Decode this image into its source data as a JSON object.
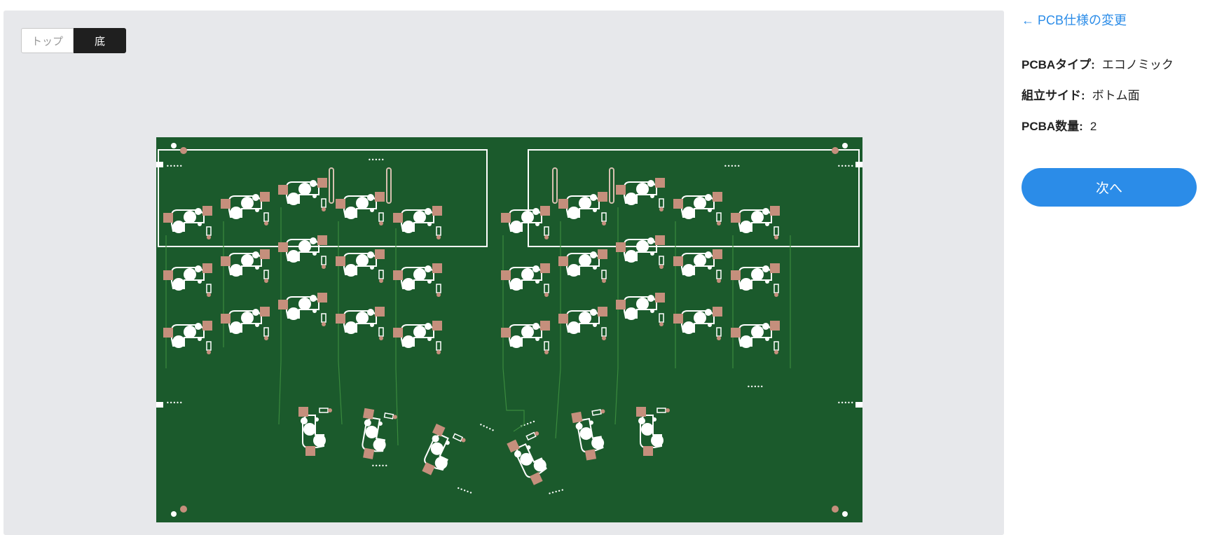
{
  "viewer": {
    "view_toggle": {
      "top_label": "トップ",
      "bottom_label": "底",
      "selected": "bottom"
    }
  },
  "panel": {
    "back_link": "← PCB仕様の変更",
    "specs": [
      {
        "label": "PCBAタイプ:",
        "value": "エコノミック"
      },
      {
        "label": "組立サイド:",
        "value": "ボトム面"
      },
      {
        "label": "PCBA数量:",
        "value": "2"
      }
    ],
    "next_button": "次へ"
  },
  "colors": {
    "accent": "#2b8ce8",
    "pcb_green": "#1b5a2c",
    "silkscreen": "#ffffff",
    "pad_copper": "#c58f7c",
    "toggle_selected": "#1f1f1f"
  }
}
